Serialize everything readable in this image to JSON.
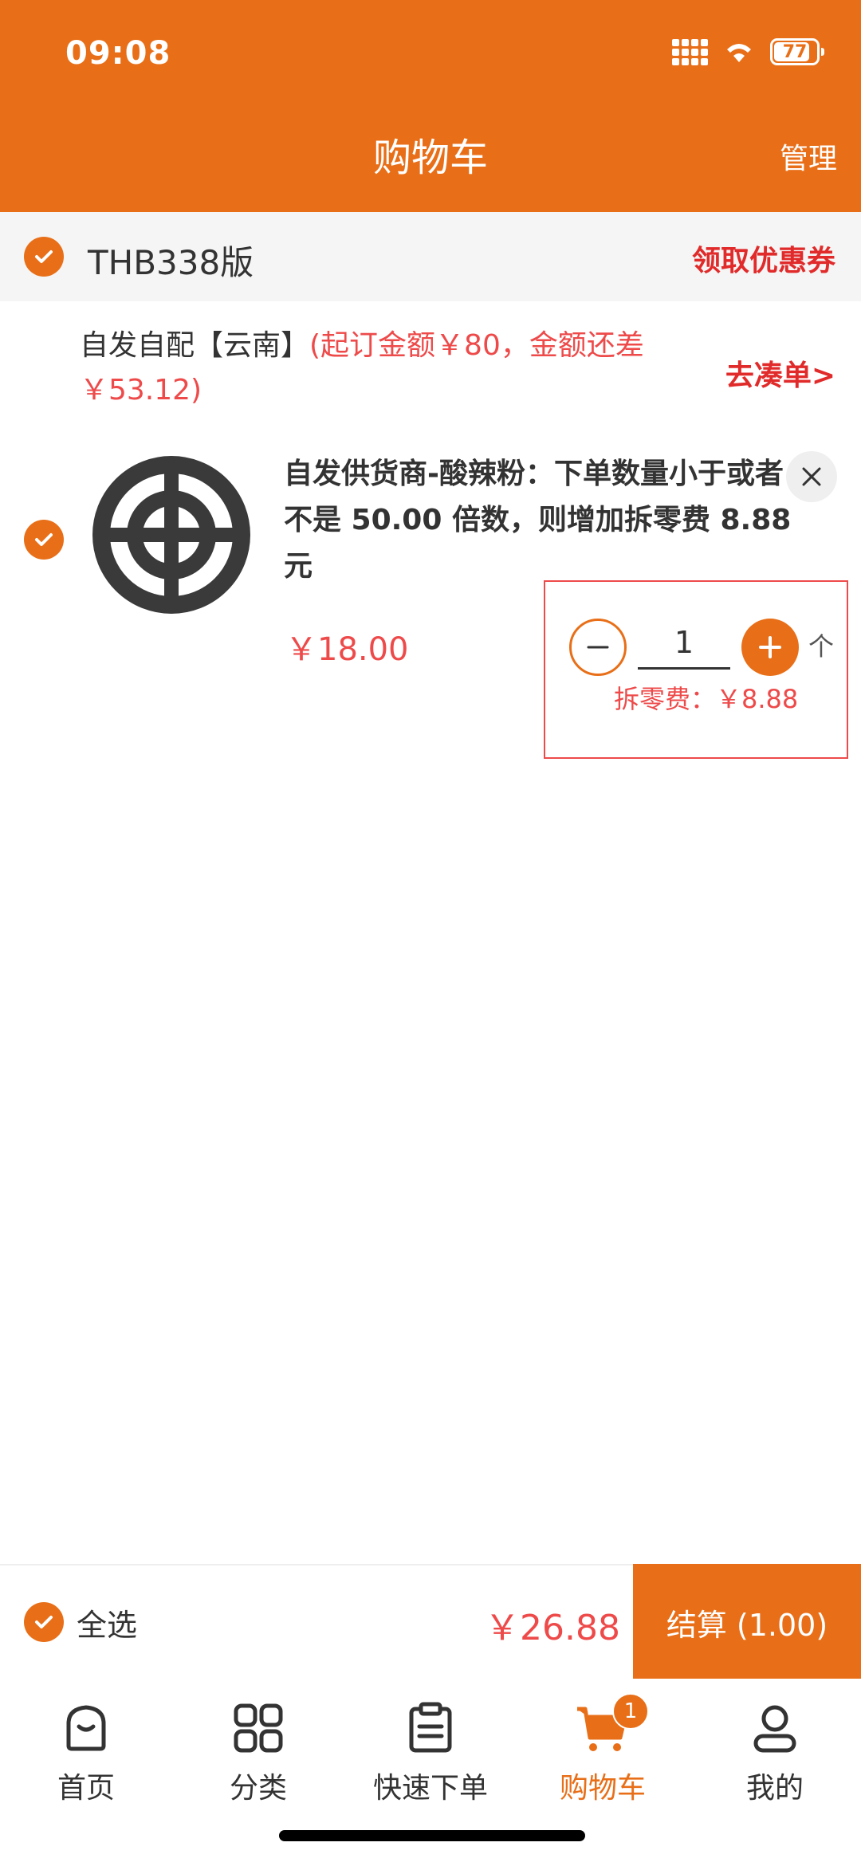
{
  "status_bar": {
    "time": "09:08",
    "battery": "77"
  },
  "header": {
    "title": "购物车",
    "manage": "管理"
  },
  "store": {
    "name": "THB338版",
    "coupon": "领取优惠券"
  },
  "notice": {
    "prefix": "自发自配【云南】",
    "warning": "(起订金额￥80，金额还差￥53.12)",
    "go_combine": "去凑单>"
  },
  "product": {
    "name": "自发供货商-酸辣粉：下单数量小于或者不是 50.00 倍数，则增加拆零费 8.88 元",
    "price": "￥18.00",
    "quantity": "1",
    "unit": "个",
    "split_fee": "拆零费：￥8.88"
  },
  "checkout": {
    "select_all": "全选",
    "total": "￥26.88",
    "button": "结算 (1.00)"
  },
  "tabbar": {
    "items": [
      {
        "label": "首页",
        "icon": "home-icon"
      },
      {
        "label": "分类",
        "icon": "grid-icon"
      },
      {
        "label": "快速下单",
        "icon": "clipboard-icon"
      },
      {
        "label": "购物车",
        "icon": "cart-icon",
        "badge": "1",
        "active": true
      },
      {
        "label": "我的",
        "icon": "person-icon"
      }
    ]
  },
  "colors": {
    "brand": "#E86F18",
    "price_red": "#EE4A4A",
    "link_red": "#E12A2A"
  }
}
